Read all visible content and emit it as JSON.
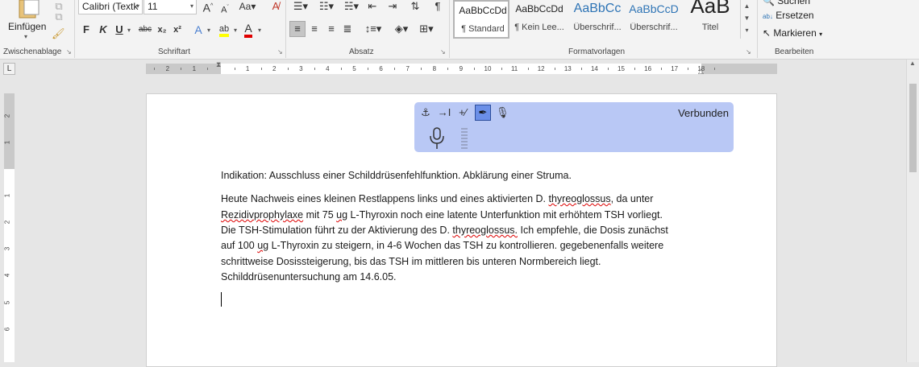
{
  "ribbon": {
    "clipboard": {
      "paste_label": "Einfügen",
      "title": "Zwischenablage"
    },
    "font": {
      "title": "Schriftart",
      "font_name": "Calibri (Textk",
      "font_size": "11",
      "bold": "F",
      "italic": "K",
      "underline": "U",
      "strike": "abc",
      "subscript": "x₂",
      "superscript": "x²",
      "font_color_letter": "A",
      "highlight_letters": "ab",
      "grow_letter": "A",
      "shrink_letter": "A"
    },
    "paragraph": {
      "title": "Absatz"
    },
    "styles": {
      "title": "Formatvorlagen",
      "items": [
        {
          "sample": "AaBbCcDd",
          "name": "¶ Standard"
        },
        {
          "sample": "AaBbCcDd",
          "name": "¶ Kein Lee..."
        },
        {
          "sample": "AaBbCc",
          "name": "Überschrif..."
        },
        {
          "sample": "AaBbCcD",
          "name": "Überschrif..."
        },
        {
          "sample": "AaB",
          "name": "Titel"
        }
      ]
    },
    "editing": {
      "title": "Bearbeiten",
      "find": "Suchen",
      "replace": "Ersetzen",
      "select": "Markieren"
    }
  },
  "ruler": {
    "labels": [
      "2",
      "1",
      "1",
      "2",
      "3",
      "4",
      "5",
      "6",
      "7",
      "8",
      "9",
      "10",
      "11",
      "12",
      "13",
      "14",
      "15",
      "16",
      "17",
      "18"
    ],
    "corner": "L"
  },
  "vruler": {
    "labels": [
      "2",
      "1",
      "1",
      "2",
      "3",
      "4",
      "5",
      "6"
    ]
  },
  "dictation": {
    "status": "Verbunden"
  },
  "document": {
    "para1": "Indikation: Ausschluss einer Schilddrüsenfehlfunktion. Abklärung einer Struma.",
    "p2l1_a": "Heute Nachweis eines kleinen Restlappens links und eines aktivierten D. ",
    "p2l1_b": "thyreoglossus",
    "p2l1_c": ", da unter",
    "p2l2_a": "Rezidivprophylaxe",
    "p2l2_b": " mit 75 ",
    "p2l2_c": "ug",
    "p2l2_d": " L-Thyroxin noch eine latente Unterfunktion mit erhöhtem TSH vorliegt.",
    "p2l3_a": "Die TSH-Stimulation führt zu der Aktivierung des D. ",
    "p2l3_b": "thyreoglossus.",
    "p2l3_c": " Ich empfehle, die Dosis zunächst",
    "p2l4_a": "auf 100 ",
    "p2l4_b": "ug",
    "p2l4_c": " L-Thyroxin zu steigern, in 4-6 Wochen das TSH zu kontrollieren. gegebenenfalls weitere",
    "p2l5": "schrittweise Dosissteigerung, bis das TSH im mittleren bis unteren Normbereich liegt.",
    "p2l6": "Schilddrüsenuntersuchung am 14.6.05."
  }
}
